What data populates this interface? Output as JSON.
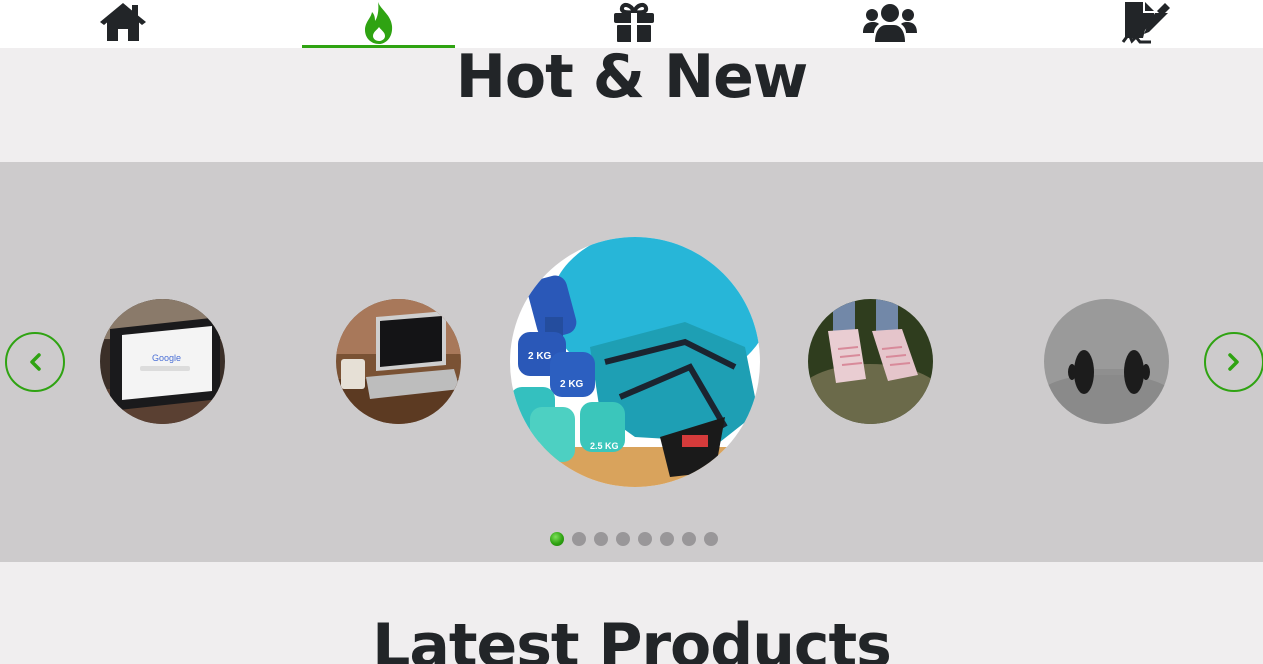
{
  "nav": {
    "items": [
      {
        "icon": "home-icon",
        "active": false
      },
      {
        "icon": "fire-icon",
        "active": true
      },
      {
        "icon": "gift-icon",
        "active": false
      },
      {
        "icon": "users-icon",
        "active": false
      },
      {
        "icon": "signature-icon",
        "active": false
      }
    ],
    "colors": {
      "active": "#2fa312",
      "icon": "#222528"
    }
  },
  "hot_new": {
    "title": "Hot & New"
  },
  "carousel": {
    "slides": [
      {
        "image": "tablet-google"
      },
      {
        "image": "laptop-desk"
      },
      {
        "image": "dumbbells-sneaker"
      },
      {
        "image": "pink-sneakers"
      },
      {
        "image": "dumbbell-gray"
      }
    ],
    "prev_icon": "chevron-left-icon",
    "next_icon": "chevron-right-icon",
    "dot_count": 8,
    "active_dot": 1,
    "colors": {
      "background": "#cdcbcc",
      "accent": "#2fa312",
      "dot": "#999799"
    }
  },
  "latest": {
    "title": "Latest Products"
  }
}
